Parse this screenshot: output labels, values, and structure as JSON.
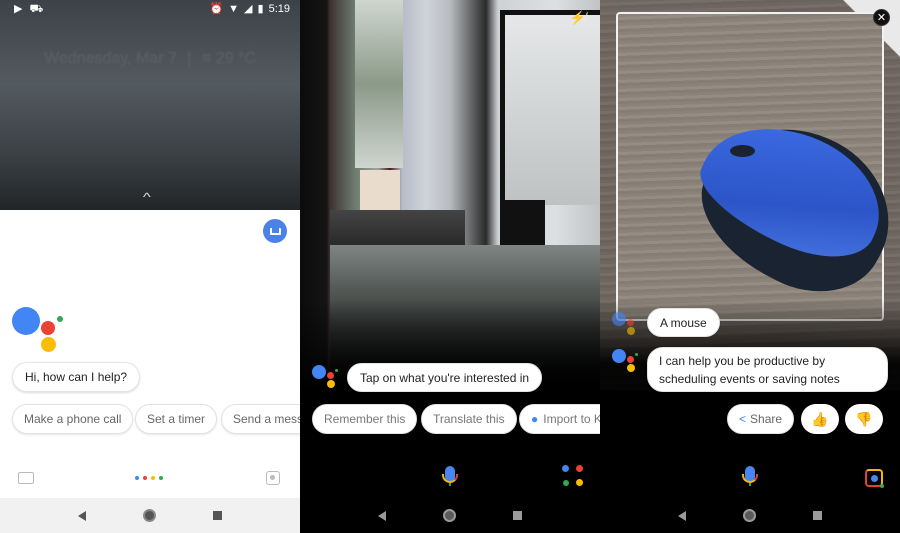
{
  "screen1": {
    "status_bar": {
      "left_icons": [
        "play-store-notification-icon",
        "car-notification-icon"
      ],
      "right_icons": [
        "alarm-icon",
        "wifi-icon",
        "signal-icon",
        "battery-icon"
      ],
      "time": "5:19"
    },
    "lockscreen": {
      "date": "Wednesday, Mar 7",
      "separator": "|",
      "weather_icon": "haze-icon",
      "temperature": "29 °C"
    },
    "expand_icon": "chevron-up-icon",
    "keyboard_button_icon": "keyboard-icon",
    "assistant_greeting": "Hi, how can I help?",
    "suggestions": [
      "Make a phone call",
      "Set a timer",
      "Send a mess"
    ],
    "bottom_bar": {
      "left_icon": "keyboard-icon",
      "center": "assistant-dots",
      "right_icon": "lens-icon"
    },
    "colors": {
      "blue": "#4285f4",
      "red": "#ea4335",
      "yellow": "#fbbc05",
      "green": "#34a853"
    }
  },
  "screen2": {
    "flash_icon": "flash-off-icon",
    "prompt": "Tap on what you're interested in",
    "suggestions": [
      "Remember this",
      "Translate this",
      "Import to K"
    ],
    "suggestion_icon": "keep-bulb-icon",
    "bottom_bar": {
      "center_icon": "mic-icon",
      "right_icon": "google-apps-dots-icon"
    }
  },
  "screen3": {
    "close_icon": "close-icon",
    "detected_label": "A mouse",
    "assistant_reply": "I can help you be productive by scheduling events or saving notes",
    "actions": {
      "share_label": "Share",
      "share_icon": "share-icon",
      "thumbs_up_icon": "thumbs-up-icon",
      "thumbs_down_icon": "thumbs-down-icon"
    },
    "bottom_bar": {
      "center_icon": "mic-icon",
      "right_icon": "lens-icon"
    }
  },
  "navbar": {
    "back": "back-icon",
    "home": "home-icon",
    "recents": "recents-icon"
  }
}
